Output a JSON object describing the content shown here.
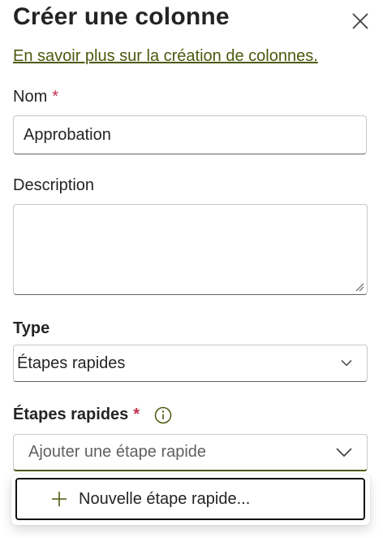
{
  "panel": {
    "title": "Créer une colonne",
    "learn_more": "En savoir plus sur la création de colonnes."
  },
  "name": {
    "label": "Nom",
    "required_mark": "*",
    "value": "Approbation"
  },
  "description": {
    "label": "Description",
    "value": ""
  },
  "type": {
    "label": "Type",
    "selected": "Étapes rapides"
  },
  "quick_steps": {
    "label": "Étapes rapides",
    "required_mark": "*",
    "placeholder": "Ajouter une étape rapide",
    "menu_item": "Nouvelle étape rapide..."
  },
  "colors": {
    "accent": "#4b5a0e",
    "required": "#c4314b"
  },
  "icons": [
    "close-icon",
    "resize-grip-icon",
    "chevron-down-icon",
    "info-icon",
    "plus-icon"
  ]
}
